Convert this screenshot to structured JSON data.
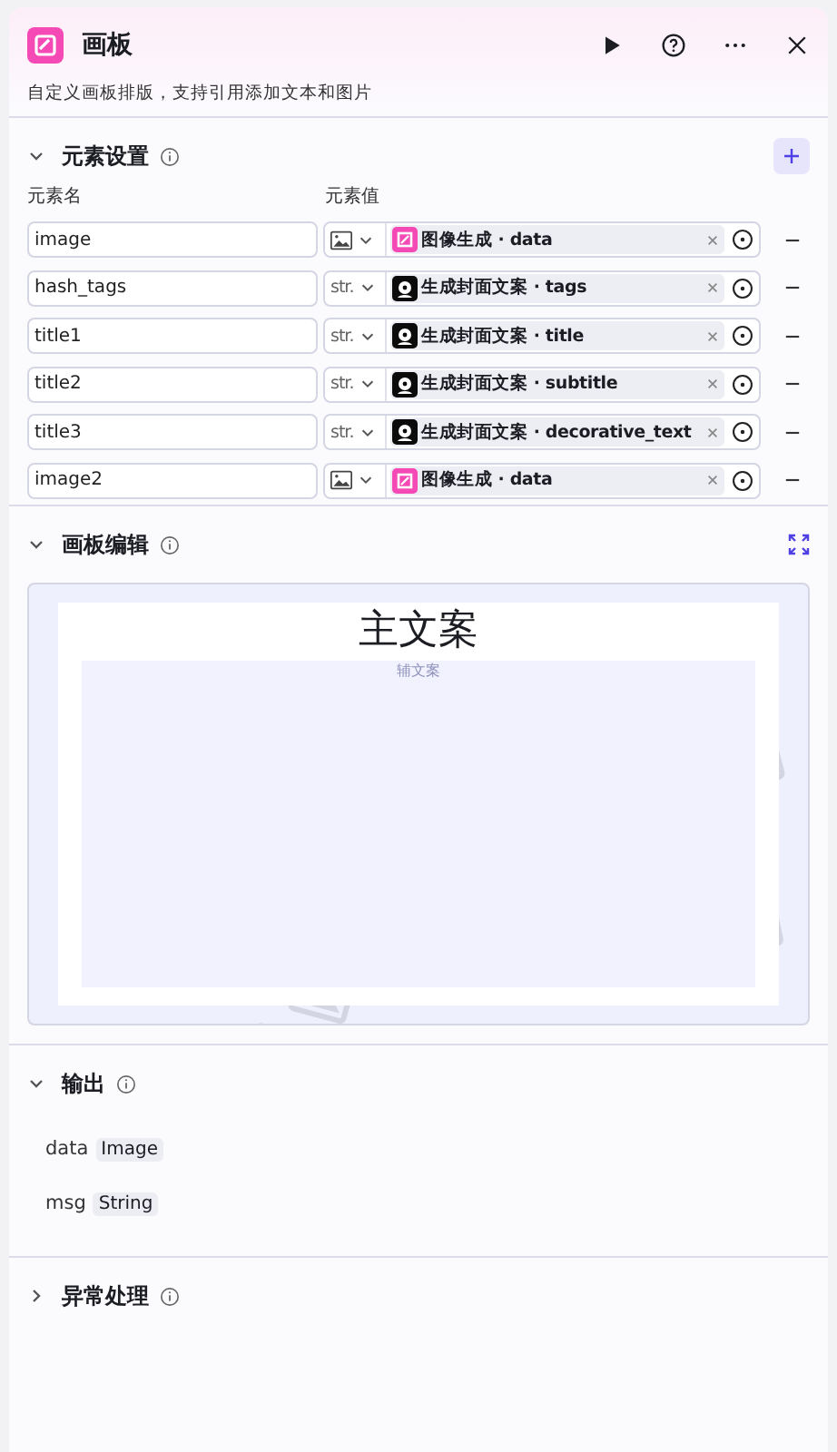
{
  "header": {
    "title": "画板",
    "description": "自定义画板排版，支持引用添加文本和图片"
  },
  "elements": {
    "title": "元素设置",
    "expanded": true,
    "name_heading": "元素名",
    "value_heading": "元素值",
    "rows": [
      {
        "name": "image",
        "type": {
          "kind": "image"
        },
        "source": {
          "kind": "image_gen",
          "text": "图像生成 · data"
        }
      },
      {
        "name": "hash_tags",
        "type": {
          "kind": "text",
          "label": "str."
        },
        "source": {
          "kind": "avatar",
          "text": "生成封面文案 · tags"
        }
      },
      {
        "name": "title1",
        "type": {
          "kind": "text",
          "label": "str."
        },
        "source": {
          "kind": "avatar",
          "text": "生成封面文案 · title"
        }
      },
      {
        "name": "title2",
        "type": {
          "kind": "text",
          "label": "str."
        },
        "source": {
          "kind": "avatar",
          "text": "生成封面文案 · subtitle"
        }
      },
      {
        "name": "title3",
        "type": {
          "kind": "text",
          "label": "str."
        },
        "source": {
          "kind": "avatar",
          "text": "生成封面文案 · decorative_text"
        }
      },
      {
        "name": "image2",
        "type": {
          "kind": "image"
        },
        "source": {
          "kind": "image_gen",
          "text": "图像生成 · data"
        }
      }
    ]
  },
  "canvas": {
    "title": "画板编辑",
    "expanded": true,
    "main_text": "主文案",
    "sub_text": "辅文案"
  },
  "output": {
    "title": "输出",
    "expanded": true,
    "items": [
      {
        "name": "data",
        "type": "Image"
      },
      {
        "name": "msg",
        "type": "String"
      }
    ]
  },
  "error_handling": {
    "title": "异常处理",
    "expanded": false
  }
}
